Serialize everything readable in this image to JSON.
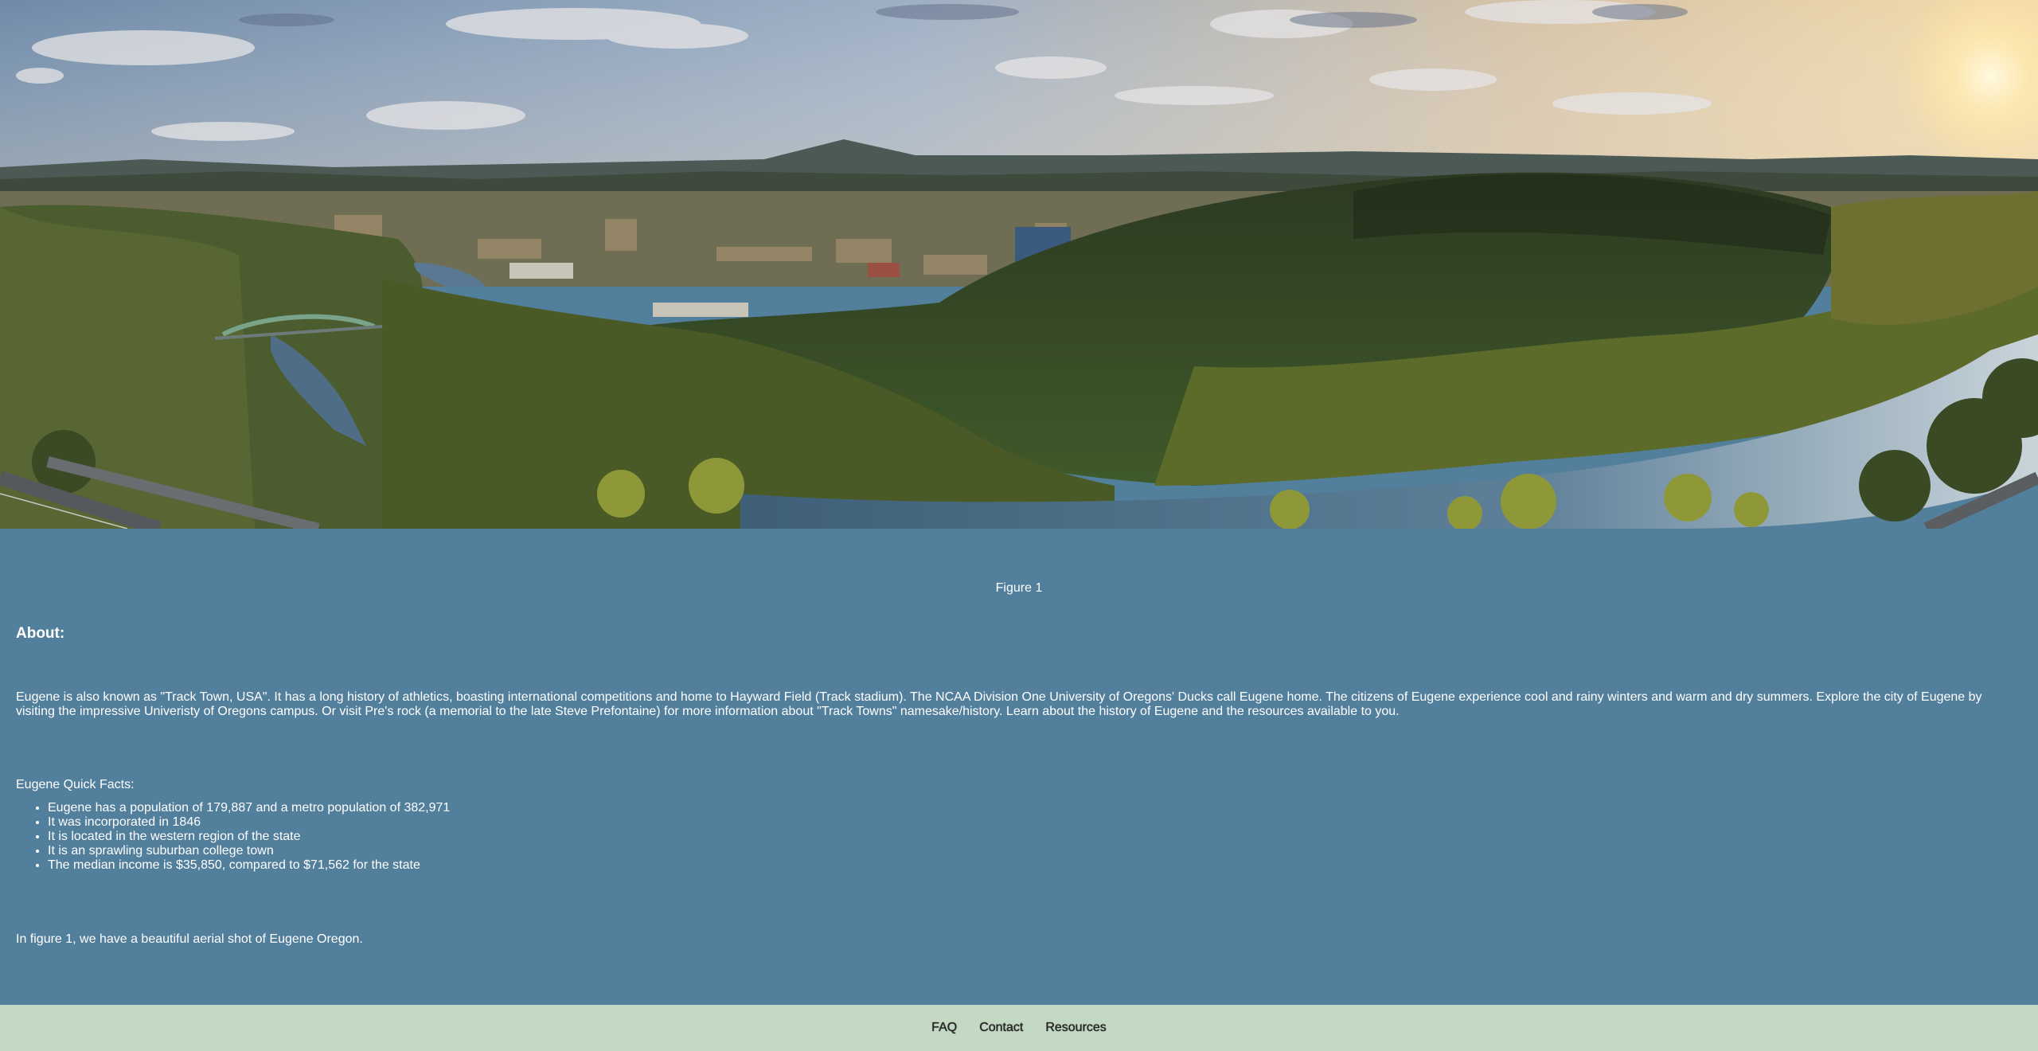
{
  "hero": {
    "alt": "Aerial shot of Eugene Oregon"
  },
  "figure": {
    "caption": "Figure 1"
  },
  "about": {
    "heading": "About:",
    "paragraph": "Eugene is also known as \"Track Town, USA\". It has a long history of athletics, boasting international competitions and home to Hayward Field (Track stadium). The NCAA Division One University of Oregons' Ducks call Eugene home. The citizens of Eugene experience cool and rainy winters and warm and dry summers. Explore the city of Eugene by visiting the impressive Univeristy of Oregons campus. Or visit Pre's rock (a memorial to the late Steve Prefontaine) for more information about \"Track Towns\" namesake/history. Learn about the history of Eugene and the resources available to you."
  },
  "facts": {
    "title": "Eugene Quick Facts:",
    "items": [
      "Eugene has a population of 179,887 and a metro population of 382,971",
      "It was incorporated in 1846",
      "It is located in the western region of the state",
      "It is an sprawling suburban college town",
      "The median income is $35,850, compared to $71,562 for the state"
    ]
  },
  "figure_note": "In figure 1, we have a beautiful aerial shot of Eugene Oregon.",
  "footer": {
    "links": [
      "FAQ",
      "Contact",
      "Resources"
    ]
  },
  "colors": {
    "content_bg": "#527f9c",
    "footer_bg": "#c3d9c3",
    "text": "#ffffff"
  }
}
